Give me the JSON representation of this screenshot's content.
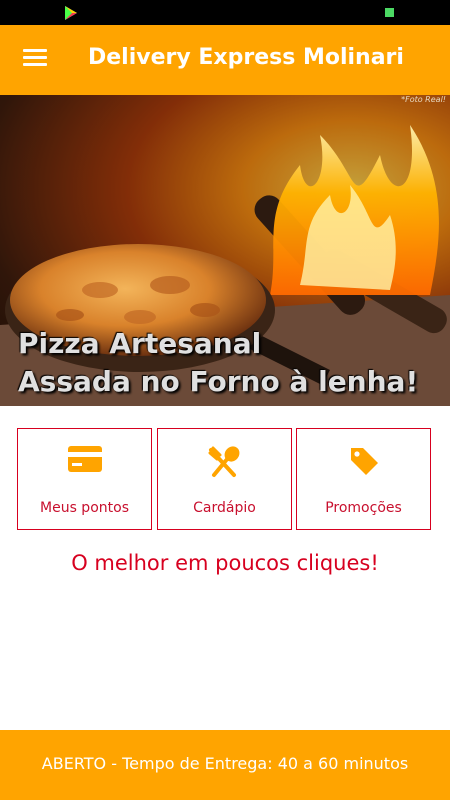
{
  "app": {
    "title": "Delivery Express Molinari"
  },
  "hero": {
    "caption": "*Foto Real!",
    "headline_line1": "Pizza Artesanal",
    "headline_line2": "Assada no Forno à lenha!"
  },
  "tiles": [
    {
      "label": "Meus pontos",
      "icon": "credit-card-icon"
    },
    {
      "label": "Cardápio",
      "icon": "fork-spoon-icon"
    },
    {
      "label": "Promoções",
      "icon": "tag-icon"
    }
  ],
  "tagline": "O melhor em poucos cliques!",
  "footer": {
    "status": "ABERTO - Tempo de Entrega: 40 a 60 minutos"
  },
  "colors": {
    "brand_orange": "#FFA400",
    "accent_red": "#D7001F",
    "white": "#FFFFFF"
  }
}
